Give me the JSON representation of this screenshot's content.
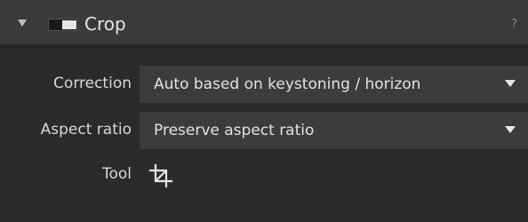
{
  "panel": {
    "title": "Crop",
    "help": "?",
    "icons": {
      "collapse": "triangle-down-icon",
      "toggle": "toggle-switch-icon",
      "tool": "crop-icon"
    }
  },
  "rows": {
    "correction": {
      "label": "Correction",
      "value": "Auto based on keystoning / horizon"
    },
    "aspect_ratio": {
      "label": "Aspect ratio",
      "value": "Preserve aspect ratio"
    },
    "tool": {
      "label": "Tool"
    }
  },
  "colors": {
    "background": "#2b2b2b",
    "header": "#3a3a3a",
    "dropdown": "#3c3c3c",
    "text": "#dcdcdc"
  }
}
